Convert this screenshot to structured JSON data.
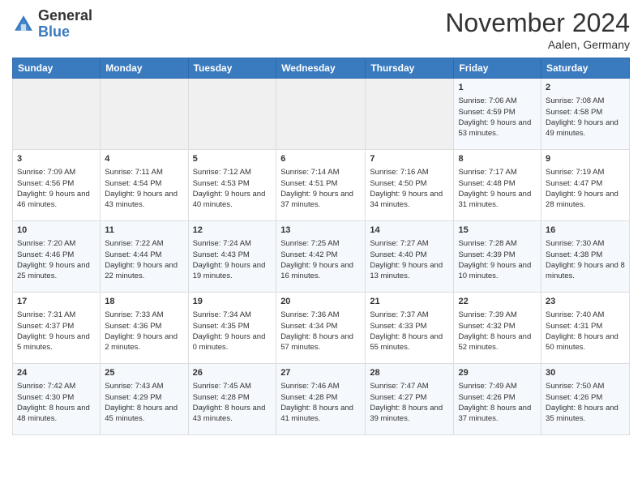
{
  "header": {
    "logo_general": "General",
    "logo_blue": "Blue",
    "month_title": "November 2024",
    "location": "Aalen, Germany"
  },
  "days_of_week": [
    "Sunday",
    "Monday",
    "Tuesday",
    "Wednesday",
    "Thursday",
    "Friday",
    "Saturday"
  ],
  "weeks": [
    [
      {
        "day": "",
        "info": ""
      },
      {
        "day": "",
        "info": ""
      },
      {
        "day": "",
        "info": ""
      },
      {
        "day": "",
        "info": ""
      },
      {
        "day": "",
        "info": ""
      },
      {
        "day": "1",
        "info": "Sunrise: 7:06 AM\nSunset: 4:59 PM\nDaylight: 9 hours and 53 minutes."
      },
      {
        "day": "2",
        "info": "Sunrise: 7:08 AM\nSunset: 4:58 PM\nDaylight: 9 hours and 49 minutes."
      }
    ],
    [
      {
        "day": "3",
        "info": "Sunrise: 7:09 AM\nSunset: 4:56 PM\nDaylight: 9 hours and 46 minutes."
      },
      {
        "day": "4",
        "info": "Sunrise: 7:11 AM\nSunset: 4:54 PM\nDaylight: 9 hours and 43 minutes."
      },
      {
        "day": "5",
        "info": "Sunrise: 7:12 AM\nSunset: 4:53 PM\nDaylight: 9 hours and 40 minutes."
      },
      {
        "day": "6",
        "info": "Sunrise: 7:14 AM\nSunset: 4:51 PM\nDaylight: 9 hours and 37 minutes."
      },
      {
        "day": "7",
        "info": "Sunrise: 7:16 AM\nSunset: 4:50 PM\nDaylight: 9 hours and 34 minutes."
      },
      {
        "day": "8",
        "info": "Sunrise: 7:17 AM\nSunset: 4:48 PM\nDaylight: 9 hours and 31 minutes."
      },
      {
        "day": "9",
        "info": "Sunrise: 7:19 AM\nSunset: 4:47 PM\nDaylight: 9 hours and 28 minutes."
      }
    ],
    [
      {
        "day": "10",
        "info": "Sunrise: 7:20 AM\nSunset: 4:46 PM\nDaylight: 9 hours and 25 minutes."
      },
      {
        "day": "11",
        "info": "Sunrise: 7:22 AM\nSunset: 4:44 PM\nDaylight: 9 hours and 22 minutes."
      },
      {
        "day": "12",
        "info": "Sunrise: 7:24 AM\nSunset: 4:43 PM\nDaylight: 9 hours and 19 minutes."
      },
      {
        "day": "13",
        "info": "Sunrise: 7:25 AM\nSunset: 4:42 PM\nDaylight: 9 hours and 16 minutes."
      },
      {
        "day": "14",
        "info": "Sunrise: 7:27 AM\nSunset: 4:40 PM\nDaylight: 9 hours and 13 minutes."
      },
      {
        "day": "15",
        "info": "Sunrise: 7:28 AM\nSunset: 4:39 PM\nDaylight: 9 hours and 10 minutes."
      },
      {
        "day": "16",
        "info": "Sunrise: 7:30 AM\nSunset: 4:38 PM\nDaylight: 9 hours and 8 minutes."
      }
    ],
    [
      {
        "day": "17",
        "info": "Sunrise: 7:31 AM\nSunset: 4:37 PM\nDaylight: 9 hours and 5 minutes."
      },
      {
        "day": "18",
        "info": "Sunrise: 7:33 AM\nSunset: 4:36 PM\nDaylight: 9 hours and 2 minutes."
      },
      {
        "day": "19",
        "info": "Sunrise: 7:34 AM\nSunset: 4:35 PM\nDaylight: 9 hours and 0 minutes."
      },
      {
        "day": "20",
        "info": "Sunrise: 7:36 AM\nSunset: 4:34 PM\nDaylight: 8 hours and 57 minutes."
      },
      {
        "day": "21",
        "info": "Sunrise: 7:37 AM\nSunset: 4:33 PM\nDaylight: 8 hours and 55 minutes."
      },
      {
        "day": "22",
        "info": "Sunrise: 7:39 AM\nSunset: 4:32 PM\nDaylight: 8 hours and 52 minutes."
      },
      {
        "day": "23",
        "info": "Sunrise: 7:40 AM\nSunset: 4:31 PM\nDaylight: 8 hours and 50 minutes."
      }
    ],
    [
      {
        "day": "24",
        "info": "Sunrise: 7:42 AM\nSunset: 4:30 PM\nDaylight: 8 hours and 48 minutes."
      },
      {
        "day": "25",
        "info": "Sunrise: 7:43 AM\nSunset: 4:29 PM\nDaylight: 8 hours and 45 minutes."
      },
      {
        "day": "26",
        "info": "Sunrise: 7:45 AM\nSunset: 4:28 PM\nDaylight: 8 hours and 43 minutes."
      },
      {
        "day": "27",
        "info": "Sunrise: 7:46 AM\nSunset: 4:28 PM\nDaylight: 8 hours and 41 minutes."
      },
      {
        "day": "28",
        "info": "Sunrise: 7:47 AM\nSunset: 4:27 PM\nDaylight: 8 hours and 39 minutes."
      },
      {
        "day": "29",
        "info": "Sunrise: 7:49 AM\nSunset: 4:26 PM\nDaylight: 8 hours and 37 minutes."
      },
      {
        "day": "30",
        "info": "Sunrise: 7:50 AM\nSunset: 4:26 PM\nDaylight: 8 hours and 35 minutes."
      }
    ]
  ]
}
